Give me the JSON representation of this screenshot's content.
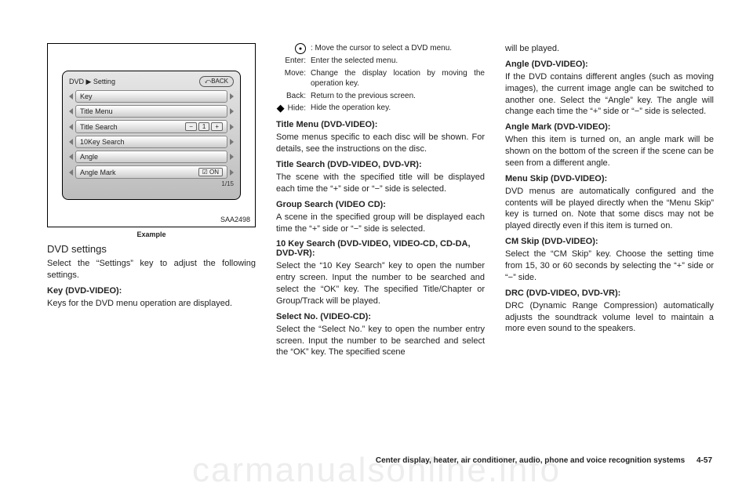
{
  "figure": {
    "code": "SAA2498",
    "caption": "Example",
    "breadcrumb": "DVD ▶ Setting",
    "back": "⤺BACK",
    "items": [
      {
        "label": "Key"
      },
      {
        "label": "Title Menu"
      },
      {
        "label": "Title Search",
        "ctrl": {
          "minus": "−",
          "value": "1",
          "plus": "+"
        }
      },
      {
        "label": "10Key Search"
      },
      {
        "label": "Angle"
      },
      {
        "label": "Angle Mark",
        "ctrl": {
          "on": "☑ ON"
        }
      }
    ],
    "pagecount": "1/15"
  },
  "col1": {
    "heading": "DVD settings",
    "intro": "Select the “Settings” key to adjust the following settings.",
    "key_h": "Key (DVD-VIDEO):",
    "key_p": "Keys for the DVD menu operation are displayed."
  },
  "col2": {
    "legend": {
      "l1": {
        "k": "",
        "v": ": Move the cursor to select a DVD menu."
      },
      "l2": {
        "k": "Enter:",
        "v": "Enter the selected menu."
      },
      "l3": {
        "k": "Move:",
        "v": "Change the display location by moving the operation key."
      },
      "l4": {
        "k": "Back:",
        "v": "Return to the previous screen."
      },
      "l5": {
        "k": "Hide:",
        "v": "Hide the operation key."
      }
    },
    "titlemenu_h": "Title Menu (DVD-VIDEO):",
    "titlemenu_p": "Some menus specific to each disc will be shown. For details, see the instructions on the disc.",
    "titlesearch_h": "Title Search (DVD-VIDEO, DVD-VR):",
    "titlesearch_p": "The scene with the specified title will be displayed each time the “+” side or “−” side is selected.",
    "groupsearch_h": "Group Search (VIDEO CD):",
    "groupsearch_p": "A scene in the specified group will be displayed each time the “+” side or “−” side is selected.",
    "tenkey_h": "10 Key Search (DVD-VIDEO, VIDEO-CD, CD-DA, DVD-VR):",
    "tenkey_p": "Select the “10 Key Search” key to open the number entry screen. Input the number to be searched and select the “OK” key. The specified Title/Chapter or Group/Track will be played.",
    "selectno_h": "Select No. (VIDEO-CD):",
    "selectno_p": "Select the “Select No.” key to open the number entry screen. Input the number to be searched and select the “OK” key. The specified scene"
  },
  "col3": {
    "cont": "will be played.",
    "angle_h": "Angle (DVD-VIDEO):",
    "angle_p": "If the DVD contains different angles (such as moving images), the current image angle can be switched to another one. Select the “Angle” key. The angle will change each time the “+” side or “−” side is selected.",
    "anglemark_h": "Angle Mark (DVD-VIDEO):",
    "anglemark_p": "When this item is turned on, an angle mark will be shown on the bottom of the screen if the scene can be seen from a different angle.",
    "menuskip_h": "Menu Skip (DVD-VIDEO):",
    "menuskip_p": "DVD menus are automatically configured and the contents will be played directly when the “Menu Skip” key is turned on. Note that some discs may not be played directly even if this item is turned on.",
    "cmskip_h": "CM Skip (DVD-VIDEO):",
    "cmskip_p": "Select the “CM Skip” key. Choose the setting time from 15, 30 or 60 seconds by selecting the “+” side or “−” side.",
    "drc_h": "DRC (DVD-VIDEO, DVD-VR):",
    "drc_p": "DRC (Dynamic Range Compression) automatically adjusts the soundtrack volume level to maintain a more even sound to the speakers."
  },
  "footer": {
    "section": "Center display, heater, air conditioner, audio, phone and voice recognition systems",
    "page": "4-57"
  },
  "watermark": "carmanualsonline.info"
}
